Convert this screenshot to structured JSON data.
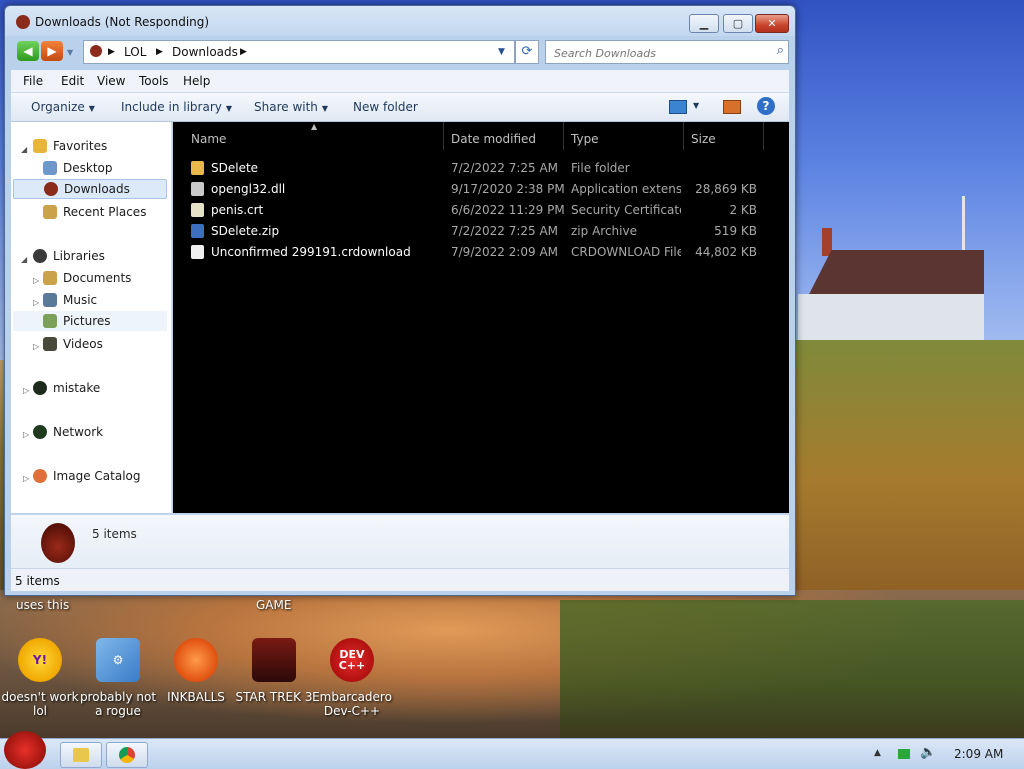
{
  "window": {
    "title": "Downloads (Not Responding)",
    "address": {
      "crumbs": [
        "LOL",
        "Downloads"
      ]
    },
    "search_placeholder": "Search Downloads",
    "menu": [
      "File",
      "Edit",
      "View",
      "Tools",
      "Help"
    ],
    "commands": {
      "organize": "Organize",
      "include": "Include in library",
      "share": "Share with",
      "new_folder": "New folder"
    },
    "nav": {
      "favorites": "Favorites",
      "desktop": "Desktop",
      "downloads": "Downloads",
      "recent": "Recent Places",
      "libraries": "Libraries",
      "documents": "Documents",
      "music": "Music",
      "pictures": "Pictures",
      "videos": "Videos",
      "mistake": "mistake",
      "network": "Network",
      "image_catalog": "Image Catalog"
    },
    "columns": {
      "name": "Name",
      "date": "Date modified",
      "type": "Type",
      "size": "Size"
    },
    "files": [
      {
        "name": "SDelete",
        "date": "7/2/2022 7:25 AM",
        "type": "File folder",
        "size": ""
      },
      {
        "name": "opengl32.dll",
        "date": "9/17/2020 2:38 PM",
        "type": "Application extens...",
        "size": "28,869 KB"
      },
      {
        "name": "penis.crt",
        "date": "6/6/2022 11:29 PM",
        "type": "Security Certificate",
        "size": "2 KB"
      },
      {
        "name": "SDelete.zip",
        "date": "7/2/2022 7:25 AM",
        "type": "zip Archive",
        "size": "519 KB"
      },
      {
        "name": "Unconfirmed 299191.crdownload",
        "date": "7/9/2022 2:09 AM",
        "type": "CRDOWNLOAD File",
        "size": "44,802 KB"
      }
    ],
    "details_text": "5 items",
    "status_text": "5 items"
  },
  "desktop": {
    "labels": {
      "uses_this": "uses this",
      "game": "GAME"
    },
    "icons": [
      {
        "label": "doesn't work lol"
      },
      {
        "label": "probably not a rogue"
      },
      {
        "label": "INKBALLS"
      },
      {
        "label": "STAR TREK 3"
      },
      {
        "label": "Embarcadero Dev-C++",
        "glyph": "DEV C++"
      }
    ]
  },
  "taskbar": {
    "clock": "2:09 AM"
  },
  "colors": {
    "accent": "#2a63b8",
    "content_bg": "#000000",
    "close": "#c8432b"
  }
}
